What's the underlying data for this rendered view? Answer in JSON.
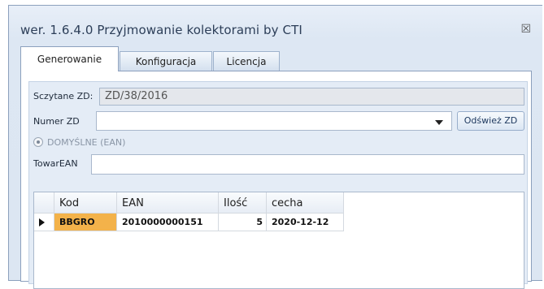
{
  "window": {
    "title": "wer. 1.6.4.0 Przyjmowanie kolektorami by CTI",
    "close_glyph": "☒"
  },
  "tabs": [
    {
      "label": "Generowanie",
      "active": true
    },
    {
      "label": "Konfiguracja",
      "active": false
    },
    {
      "label": "Licencja",
      "active": false
    }
  ],
  "form": {
    "read_zd_label": "Sczytane ZD:",
    "read_zd_value": "ZD/38/2016",
    "numer_zd_label": "Numer ZD",
    "numer_zd_value": "",
    "refresh_button": "Odśwież ZD",
    "mode_radio_label": "DOMYŚLNE (EAN)",
    "towar_ean_label": "TowarEAN",
    "towar_ean_value": ""
  },
  "grid": {
    "columns": [
      "Kod",
      "EAN",
      "Ilość",
      "cecha"
    ],
    "rows": [
      {
        "kod": "BBGRO",
        "ean": "2010000000151",
        "ilosc": "5",
        "cecha": "2020-12-12",
        "selected": true
      }
    ]
  },
  "colors": {
    "selected_cell": "#f3b24a",
    "window_bg": "#dce6f2",
    "accent": "#2c3e58"
  },
  "icons": {
    "close": "close-icon",
    "dropdown": "chevron-down-icon",
    "row_indicator": "row-pointer-icon"
  }
}
